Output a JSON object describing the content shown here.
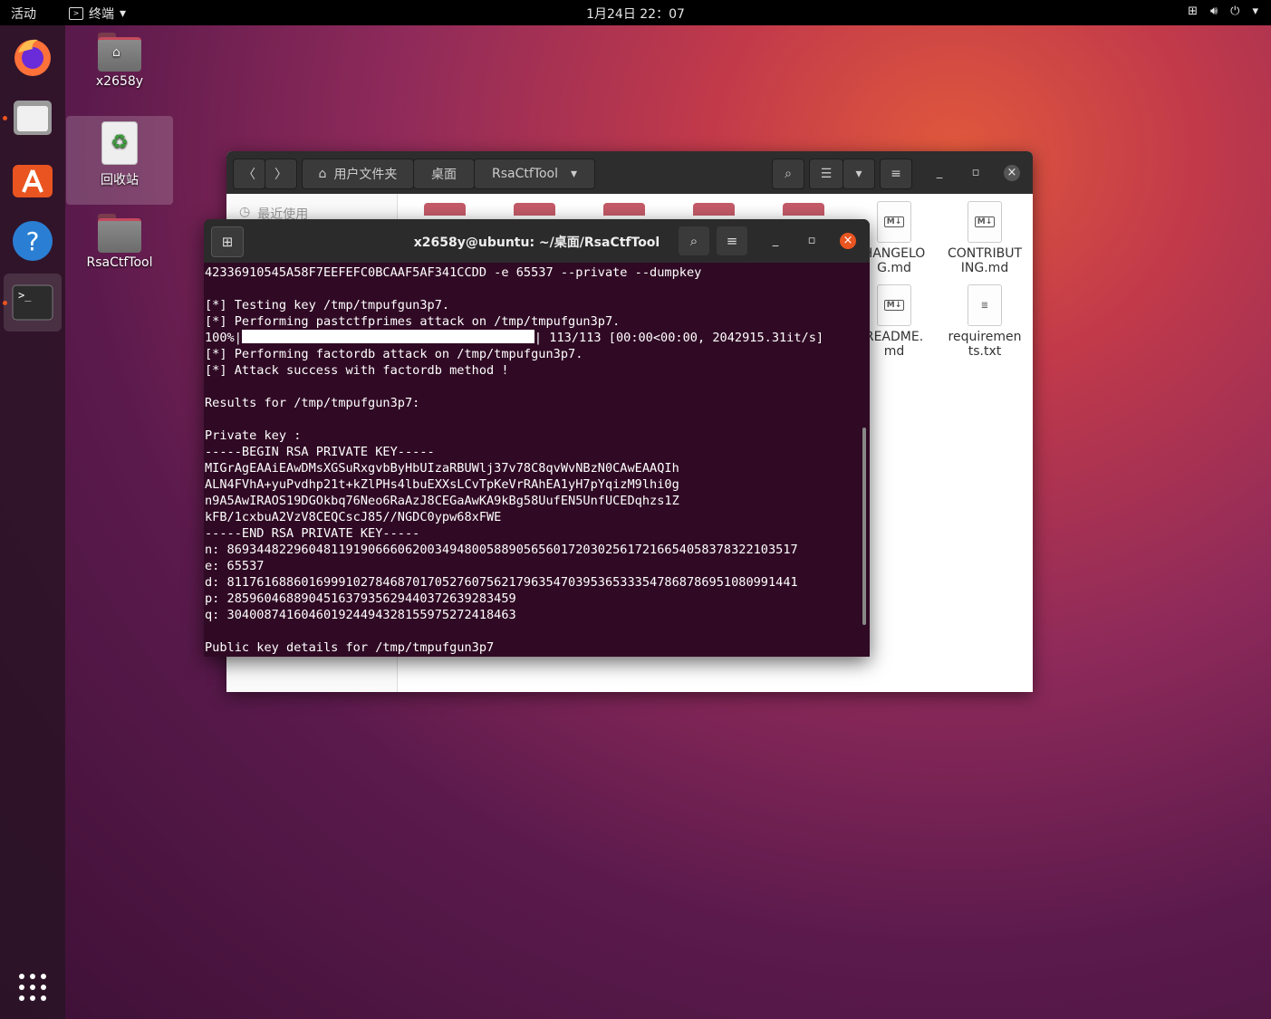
{
  "topbar": {
    "activities": "活动",
    "app_name": "终端",
    "clock": "1月24日 22：07"
  },
  "dock": {
    "items": [
      "firefox-icon",
      "files-icon",
      "software-icon",
      "help-icon",
      "terminal-icon"
    ],
    "show_apps": "show-apps-icon"
  },
  "desktop": {
    "home_label": "x2658y",
    "trash_label": "回收站",
    "folder_label": "RsaCtfTool"
  },
  "file_manager": {
    "breadcrumb_home": "用户文件夹",
    "breadcrumb_desktop": "桌面",
    "breadcrumb_current": "RsaCtfTool",
    "sidebar_recent": "最近使用",
    "files": [
      {
        "name": "HANGELO G.md",
        "line1": "HANGELO",
        "line2": "G.md"
      },
      {
        "name": "CONTRIBUT ING.md",
        "line1": "CONTRIBUT",
        "line2": "ING.md"
      },
      {
        "name": "README. md",
        "line1": "README.",
        "line2": "md"
      },
      {
        "name": "requiremen ts.txt",
        "line1": "requiremen",
        "line2": "ts.txt"
      }
    ]
  },
  "terminal": {
    "title": "x2658y@ubuntu: ~/桌面/RsaCtfTool",
    "lines": {
      "l1": "42336910545A58F7EEFEFC0BCAAF5AF341CCDD -e 65537 --private --dumpkey",
      "l2": "[*] Testing key /tmp/tmpufgun3p7.",
      "l3": "[*] Performing pastctfprimes attack on /tmp/tmpufgun3p7.",
      "l4a": "100%|",
      "l4b": "| 113/113 [00:00<00:00, 2042915.31it/s]",
      "l5": "[*] Performing factordb attack on /tmp/tmpufgun3p7.",
      "l6": "[*] Attack success with factordb method !",
      "l7": "Results for /tmp/tmpufgun3p7:",
      "l8": "Private key :",
      "l9": "-----BEGIN RSA PRIVATE KEY-----",
      "l10": "MIGrAgEAAiEAwDMsXGSuRxgvbByHbUIzaRBUWlj37v78C8qvWvNBzN0CAwEAAQIh",
      "l11": "ALN4FVhA+yuPvdhp21t+kZlPHs4lbuEXXsLCvTpKeVrRAhEA1yH7pYqizM9lhi0g",
      "l12": "n9A5AwIRAOS19DGOkbq76Neo6RaAzJ8CEGaAwKA9kBg58UufEN5UnfUCEDqhzs1Z",
      "l13": "kFB/1cxbuA2VzV8CEQCscJ85//NGDC0ypw68xFWE",
      "l14": "-----END RSA PRIVATE KEY-----",
      "l15": "n: 86934482296048119190666062003494800588905656017203025617216654058378322103517",
      "l16": "e: 65537",
      "l17": "d: 81176168860169991027846870170527607562179635470395365333547868786951080991441",
      "l18": "p: 285960468890451637935629440372639283459",
      "l19": "q: 304008741604601924494328155975272418463",
      "l20": "Public key details for /tmp/tmpufgun3p7"
    }
  }
}
